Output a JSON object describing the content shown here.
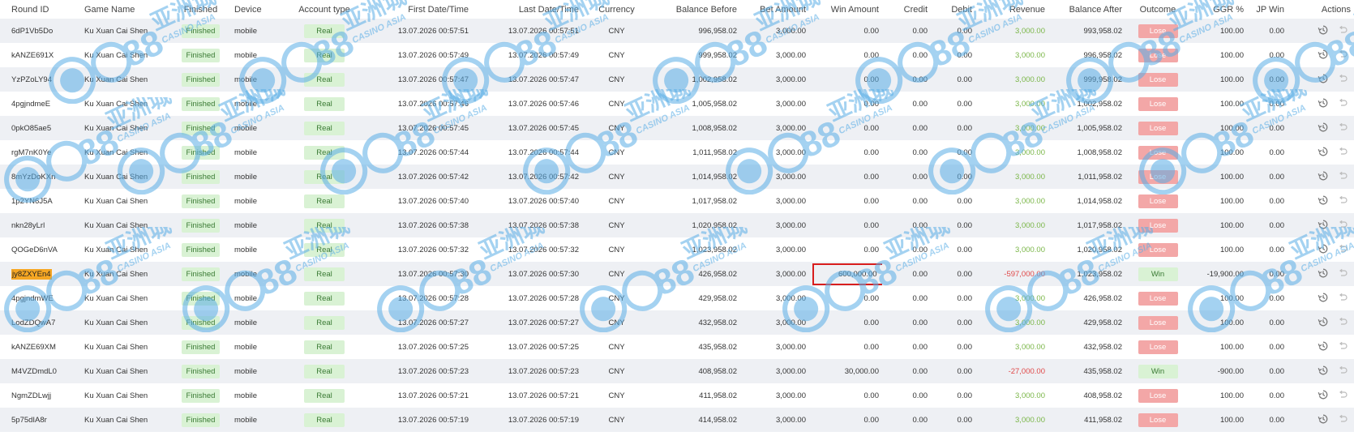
{
  "columns": [
    "Round ID",
    "Game Name",
    "Finished",
    "Device",
    "Account type",
    "First Date/Time",
    "Last Date/Time",
    "Currency",
    "Balance Before",
    "Bet Amount",
    "Win Amount",
    "Credit",
    "Debit",
    "Revenue",
    "Balance After",
    "Outcome",
    "GGR %",
    "JP Win",
    "Actions"
  ],
  "rows": [
    {
      "id": "6dP1Vb5Do",
      "game": "Ku Xuan Cai Shen",
      "finished": "Finished",
      "device": "mobile",
      "acct": "Real",
      "first": "13.07.2026 00:57:51",
      "last": "13.07.2026 00:57:51",
      "cur": "CNY",
      "bal_before": "996,958.02",
      "bet": "3,000.00",
      "win": "0.00",
      "credit": "0.00",
      "debit": "0.00",
      "revenue": "3,000.00",
      "bal_after": "993,958.02",
      "outcome": "Lose",
      "ggr": "100.00",
      "jp": "0.00"
    },
    {
      "id": "kANZE691X",
      "game": "Ku Xuan Cai Shen",
      "finished": "Finished",
      "device": "mobile",
      "acct": "Real",
      "first": "13.07.2026 00:57:49",
      "last": "13.07.2026 00:57:49",
      "cur": "CNY",
      "bal_before": "999,958.02",
      "bet": "3,000.00",
      "win": "0.00",
      "credit": "0.00",
      "debit": "0.00",
      "revenue": "3,000.00",
      "bal_after": "996,958.02",
      "outcome": "Lose",
      "ggr": "100.00",
      "jp": "0.00"
    },
    {
      "id": "YzPZoLY94",
      "game": "Ku Xuan Cai Shen",
      "finished": "Finished",
      "device": "mobile",
      "acct": "Real",
      "first": "13.07.2026 00:57:47",
      "last": "13.07.2026 00:57:47",
      "cur": "CNY",
      "bal_before": "1,002,958.02",
      "bet": "3,000.00",
      "win": "0.00",
      "credit": "0.00",
      "debit": "0.00",
      "revenue": "3,000.00",
      "bal_after": "999,958.02",
      "outcome": "Lose",
      "ggr": "100.00",
      "jp": "0.00"
    },
    {
      "id": "4pgjndmeE",
      "game": "Ku Xuan Cai Shen",
      "finished": "Finished",
      "device": "mobile",
      "acct": "Real",
      "first": "13.07.2026 00:57:46",
      "last": "13.07.2026 00:57:46",
      "cur": "CNY",
      "bal_before": "1,005,958.02",
      "bet": "3,000.00",
      "win": "0.00",
      "credit": "0.00",
      "debit": "0.00",
      "revenue": "3,000.00",
      "bal_after": "1,002,958.02",
      "outcome": "Lose",
      "ggr": "100.00",
      "jp": "0.00"
    },
    {
      "id": "0pkO85ae5",
      "game": "Ku Xuan Cai Shen",
      "finished": "Finished",
      "device": "mobile",
      "acct": "Real",
      "first": "13.07.2026 00:57:45",
      "last": "13.07.2026 00:57:45",
      "cur": "CNY",
      "bal_before": "1,008,958.02",
      "bet": "3,000.00",
      "win": "0.00",
      "credit": "0.00",
      "debit": "0.00",
      "revenue": "3,000.00",
      "bal_after": "1,005,958.02",
      "outcome": "Lose",
      "ggr": "100.00",
      "jp": "0.00"
    },
    {
      "id": "rgM7nK0Ye",
      "game": "Ku Xuan Cai Shen",
      "finished": "Finished",
      "device": "mobile",
      "acct": "Real",
      "first": "13.07.2026 00:57:44",
      "last": "13.07.2026 00:57:44",
      "cur": "CNY",
      "bal_before": "1,011,958.02",
      "bet": "3,000.00",
      "win": "0.00",
      "credit": "0.00",
      "debit": "0.00",
      "revenue": "3,000.00",
      "bal_after": "1,008,958.02",
      "outcome": "Lose",
      "ggr": "100.00",
      "jp": "0.00"
    },
    {
      "id": "8mYzDoKXn",
      "game": "Ku Xuan Cai Shen",
      "finished": "Finished",
      "device": "mobile",
      "acct": "Real",
      "first": "13.07.2026 00:57:42",
      "last": "13.07.2026 00:57:42",
      "cur": "CNY",
      "bal_before": "1,014,958.02",
      "bet": "3,000.00",
      "win": "0.00",
      "credit": "0.00",
      "debit": "0.00",
      "revenue": "3,000.00",
      "bal_after": "1,011,958.02",
      "outcome": "Lose",
      "ggr": "100.00",
      "jp": "0.00"
    },
    {
      "id": "1p2YN6J5A",
      "game": "Ku Xuan Cai Shen",
      "finished": "Finished",
      "device": "mobile",
      "acct": "Real",
      "first": "13.07.2026 00:57:40",
      "last": "13.07.2026 00:57:40",
      "cur": "CNY",
      "bal_before": "1,017,958.02",
      "bet": "3,000.00",
      "win": "0.00",
      "credit": "0.00",
      "debit": "0.00",
      "revenue": "3,000.00",
      "bal_after": "1,014,958.02",
      "outcome": "Lose",
      "ggr": "100.00",
      "jp": "0.00"
    },
    {
      "id": "nkn28yLrl",
      "game": "Ku Xuan Cai Shen",
      "finished": "Finished",
      "device": "mobile",
      "acct": "Real",
      "first": "13.07.2026 00:57:38",
      "last": "13.07.2026 00:57:38",
      "cur": "CNY",
      "bal_before": "1,020,958.02",
      "bet": "3,000.00",
      "win": "0.00",
      "credit": "0.00",
      "debit": "0.00",
      "revenue": "3,000.00",
      "bal_after": "1,017,958.02",
      "outcome": "Lose",
      "ggr": "100.00",
      "jp": "0.00"
    },
    {
      "id": "QOGeD6nVA",
      "game": "Ku Xuan Cai Shen",
      "finished": "Finished",
      "device": "mobile",
      "acct": "Real",
      "first": "13.07.2026 00:57:32",
      "last": "13.07.2026 00:57:32",
      "cur": "CNY",
      "bal_before": "1,023,958.02",
      "bet": "3,000.00",
      "win": "0.00",
      "credit": "0.00",
      "debit": "0.00",
      "revenue": "3,000.00",
      "bal_after": "1,020,958.02",
      "outcome": "Lose",
      "ggr": "100.00",
      "jp": "0.00"
    },
    {
      "id": "jy8ZXYEn4",
      "game": "Ku Xuan Cai Shen",
      "finished": "Finished",
      "device": "mobile",
      "acct": "Real",
      "first": "13.07.2026 00:57:30",
      "last": "13.07.2026 00:57:30",
      "cur": "CNY",
      "bal_before": "426,958.02",
      "bet": "3,000.00",
      "win": "600,000.00",
      "credit": "0.00",
      "debit": "0.00",
      "revenue": "-597,000.00",
      "bal_after": "1,023,958.02",
      "outcome": "Win",
      "ggr": "-19,900.00",
      "jp": "0.00",
      "highlight_id": true,
      "boxed_win": true
    },
    {
      "id": "4pgjndmWE",
      "game": "Ku Xuan Cai Shen",
      "finished": "Finished",
      "device": "mobile",
      "acct": "Real",
      "first": "13.07.2026 00:57:28",
      "last": "13.07.2026 00:57:28",
      "cur": "CNY",
      "bal_before": "429,958.02",
      "bet": "3,000.00",
      "win": "0.00",
      "credit": "0.00",
      "debit": "0.00",
      "revenue": "3,000.00",
      "bal_after": "426,958.02",
      "outcome": "Lose",
      "ggr": "100.00",
      "jp": "0.00"
    },
    {
      "id": "LodZDQwA7",
      "game": "Ku Xuan Cai Shen",
      "finished": "Finished",
      "device": "mobile",
      "acct": "Real",
      "first": "13.07.2026 00:57:27",
      "last": "13.07.2026 00:57:27",
      "cur": "CNY",
      "bal_before": "432,958.02",
      "bet": "3,000.00",
      "win": "0.00",
      "credit": "0.00",
      "debit": "0.00",
      "revenue": "3,000.00",
      "bal_after": "429,958.02",
      "outcome": "Lose",
      "ggr": "100.00",
      "jp": "0.00"
    },
    {
      "id": "kANZE69XM",
      "game": "Ku Xuan Cai Shen",
      "finished": "Finished",
      "device": "mobile",
      "acct": "Real",
      "first": "13.07.2026 00:57:25",
      "last": "13.07.2026 00:57:25",
      "cur": "CNY",
      "bal_before": "435,958.02",
      "bet": "3,000.00",
      "win": "0.00",
      "credit": "0.00",
      "debit": "0.00",
      "revenue": "3,000.00",
      "bal_after": "432,958.02",
      "outcome": "Lose",
      "ggr": "100.00",
      "jp": "0.00"
    },
    {
      "id": "M4VZDmdL0",
      "game": "Ku Xuan Cai Shen",
      "finished": "Finished",
      "device": "mobile",
      "acct": "Real",
      "first": "13.07.2026 00:57:23",
      "last": "13.07.2026 00:57:23",
      "cur": "CNY",
      "bal_before": "408,958.02",
      "bet": "3,000.00",
      "win": "30,000.00",
      "credit": "0.00",
      "debit": "0.00",
      "revenue": "-27,000.00",
      "bal_after": "435,958.02",
      "outcome": "Win",
      "ggr": "-900.00",
      "jp": "0.00"
    },
    {
      "id": "NgmZDLwjj",
      "game": "Ku Xuan Cai Shen",
      "finished": "Finished",
      "device": "mobile",
      "acct": "Real",
      "first": "13.07.2026 00:57:21",
      "last": "13.07.2026 00:57:21",
      "cur": "CNY",
      "bal_before": "411,958.02",
      "bet": "3,000.00",
      "win": "0.00",
      "credit": "0.00",
      "debit": "0.00",
      "revenue": "3,000.00",
      "bal_after": "408,958.02",
      "outcome": "Lose",
      "ggr": "100.00",
      "jp": "0.00"
    },
    {
      "id": "5p75dIA8r",
      "game": "Ku Xuan Cai Shen",
      "finished": "Finished",
      "device": "mobile",
      "acct": "Real",
      "first": "13.07.2026 00:57:19",
      "last": "13.07.2026 00:57:19",
      "cur": "CNY",
      "bal_before": "414,958.02",
      "bet": "3,000.00",
      "win": "0.00",
      "credit": "0.00",
      "debit": "0.00",
      "revenue": "3,000.00",
      "bal_after": "411,958.02",
      "outcome": "Lose",
      "ggr": "100.00",
      "jp": "0.00"
    }
  ],
  "watermark": {
    "brand": "C188",
    "cjk": "亚洲城",
    "sub": "CASINO ASIA",
    "color": "#5aaee6"
  },
  "icons": {
    "history": "history-icon",
    "undo": "undo-icon"
  },
  "colors": {
    "highlight": "#f5a623",
    "box": "#d81e1e",
    "lose": "#f3a7a7",
    "win_badge": "#d9f2d4",
    "revenue_positive": "#7ab648",
    "revenue_negative": "#e04848"
  }
}
